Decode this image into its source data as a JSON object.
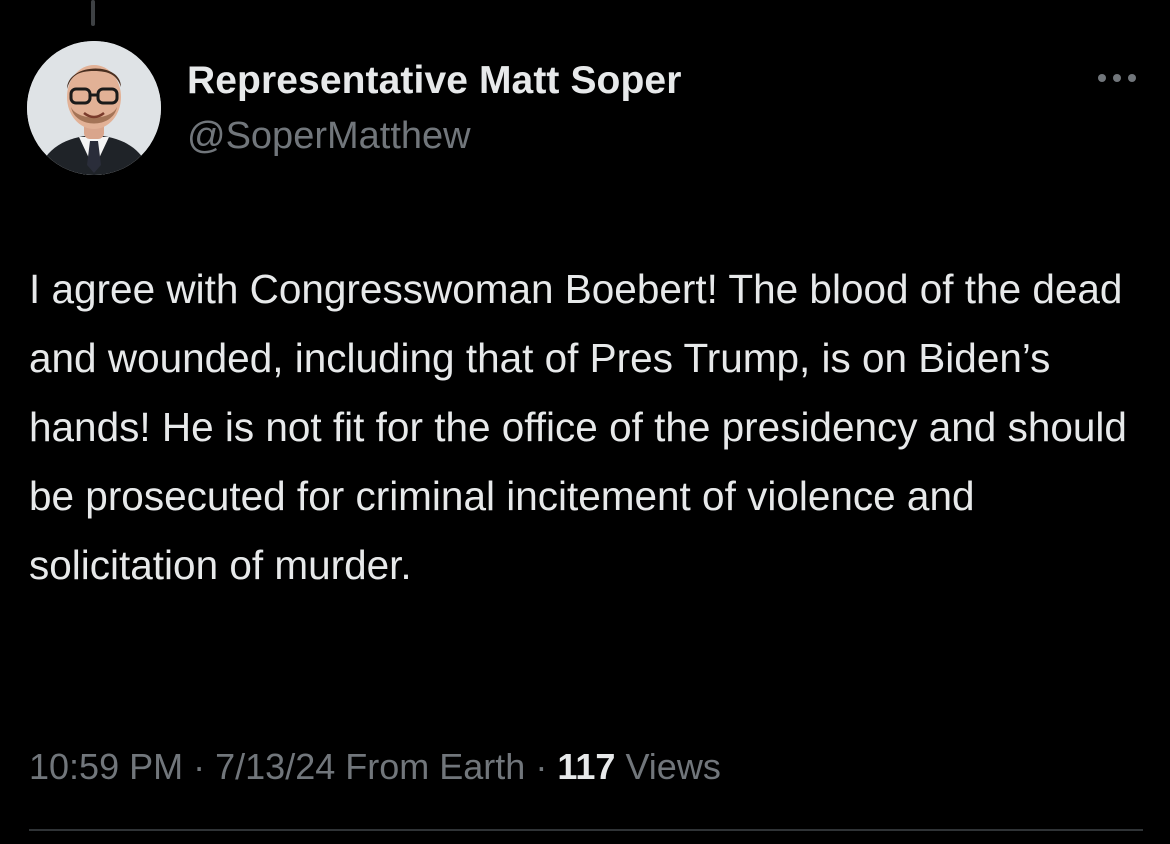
{
  "tweet": {
    "author": {
      "display_name": "Representative Matt Soper",
      "handle": "@SoperMatthew",
      "avatar_icon": "profile-photo"
    },
    "more_icon": "more-horizontal-icon",
    "text": "I agree with Congresswoman Boebert! The blood of the dead and wounded, including that of Pres Trump, is on Biden’s hands! He is not fit for the office of the presidency and should be prosecuted for criminal incitement of violence and  solicitation of murder.",
    "time": "10:59 PM",
    "date": "7/13/24",
    "location": "From Earth",
    "separator": "·",
    "views_count": "117",
    "views_label": "Views"
  },
  "colors": {
    "background": "#000000",
    "primary_text": "#e7e9ea",
    "secondary_text": "#71767b",
    "divider": "#2f3336"
  }
}
